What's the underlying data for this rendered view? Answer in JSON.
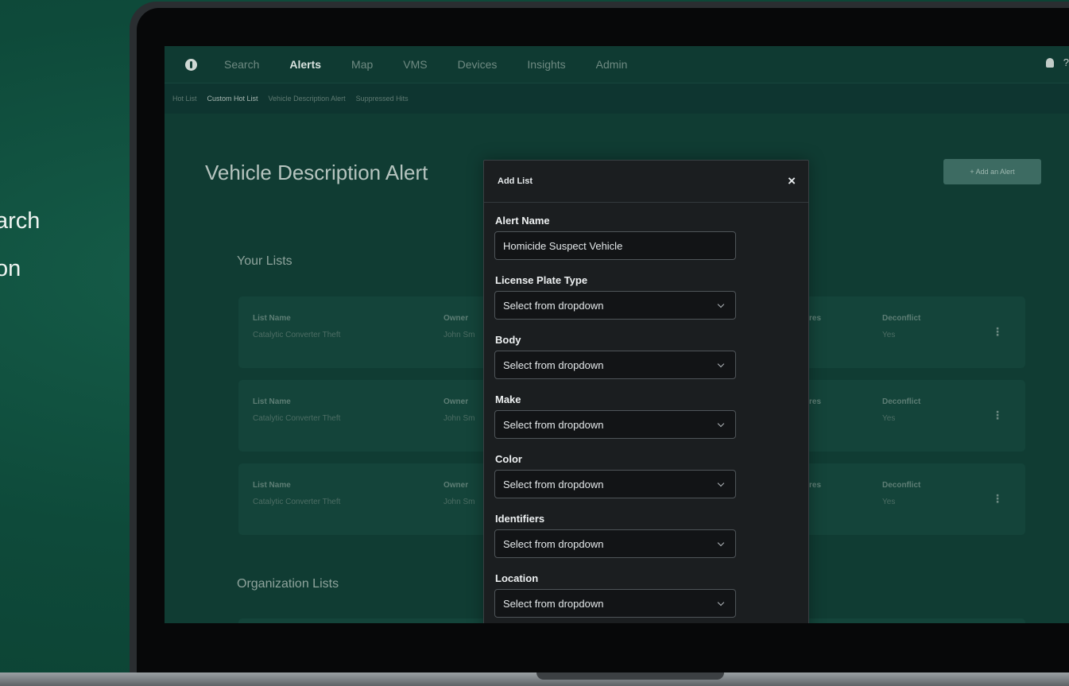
{
  "promo": {
    "line1": "arch",
    "line2": "on"
  },
  "nav": {
    "items": [
      {
        "label": "Search",
        "active": false
      },
      {
        "label": "Alerts",
        "active": true
      },
      {
        "label": "Map",
        "active": false
      },
      {
        "label": "VMS",
        "active": false
      },
      {
        "label": "Devices",
        "active": false
      },
      {
        "label": "Insights",
        "active": false
      },
      {
        "label": "Admin",
        "active": false
      }
    ],
    "help": "?"
  },
  "subnav": {
    "items": [
      {
        "label": "Hot List",
        "active": false
      },
      {
        "label": "Custom Hot List",
        "active": true
      },
      {
        "label": "Vehicle Description Alert",
        "active": false
      },
      {
        "label": "Suppressed Hits",
        "active": false
      }
    ]
  },
  "page": {
    "title": "Vehicle Description Alert",
    "add_button": "+ Add an Alert",
    "your_lists_title": "Your Lists",
    "org_lists_title": "Organization Lists"
  },
  "cards": [
    {
      "list_name_label": "List Name",
      "list_name": "Catalytic Converter Theft",
      "owner_label": "Owner",
      "owner": "John Sm",
      "col3_label": "res",
      "decon_label": "Deconflict",
      "decon": "Yes"
    },
    {
      "list_name_label": "List Name",
      "list_name": "Catalytic Converter Theft",
      "owner_label": "Owner",
      "owner": "John Sm",
      "col3_label": "res",
      "decon_label": "Deconflict",
      "decon": "Yes"
    },
    {
      "list_name_label": "List Name",
      "list_name": "Catalytic Converter Theft",
      "owner_label": "Owner",
      "owner": "John Sm",
      "col3_label": "res",
      "decon_label": "Deconflict",
      "decon": "Yes"
    }
  ],
  "modal": {
    "title": "Add List",
    "close": "×",
    "alert_name_label": "Alert Name",
    "alert_name_value": "Homicide Suspect Vehicle",
    "fields": [
      {
        "label": "License Plate Type",
        "value": "Select from dropdown"
      },
      {
        "label": "Body",
        "value": "Select from dropdown"
      },
      {
        "label": "Make",
        "value": "Select from dropdown"
      },
      {
        "label": "Color",
        "value": "Select from dropdown"
      },
      {
        "label": "Identifiers",
        "value": "Select from dropdown"
      },
      {
        "label": "Location",
        "value": "Select from dropdown"
      }
    ]
  }
}
